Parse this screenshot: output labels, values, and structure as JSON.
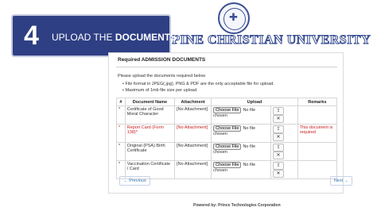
{
  "step": {
    "number": "4",
    "text_prefix": "UPLOAD THE ",
    "text_bold": "DOCUMENTS"
  },
  "school": {
    "name": "PPINE CHRISTIAN UNIVERSITY"
  },
  "panel": {
    "title": "Required ADMISSION DOCUMENTS",
    "instruction": "Please upload the documents required below",
    "bullets": [
      "File format in JPEG(.jpg), PNG & PDF are the only acceptable file for upload.",
      "Maximum of 1mb file size per upload."
    ]
  },
  "table": {
    "headers": [
      "#",
      "Document Name",
      "Attachment",
      "Upload",
      "",
      "Remarks"
    ],
    "file_button": "Choose File",
    "no_file": "No file chosen",
    "rows": [
      {
        "mark": "*",
        "name": "Certificate of Good Moral Character",
        "attachment": "[No Attachment]",
        "remarks": "",
        "highlight": false
      },
      {
        "mark": "*",
        "name": "Report Card (Form 138)*",
        "attachment": "[No Attachment]",
        "remarks": "This document is required",
        "highlight": true
      },
      {
        "mark": "*",
        "name": "Original (PSA) Birth Certificate",
        "attachment": "[No Attachment]",
        "remarks": "",
        "highlight": false
      },
      {
        "mark": "*",
        "name": "Vaccination Certificate / Card",
        "attachment": "[No Attachment]",
        "remarks": "",
        "highlight": false
      }
    ]
  },
  "nav": {
    "previous": "← Previous",
    "next": "Next →"
  },
  "footer": {
    "powered": "Powered by: Prince Technologies Corporation"
  },
  "colors": {
    "banner": "#2f3f84",
    "required": "#c8201f"
  }
}
